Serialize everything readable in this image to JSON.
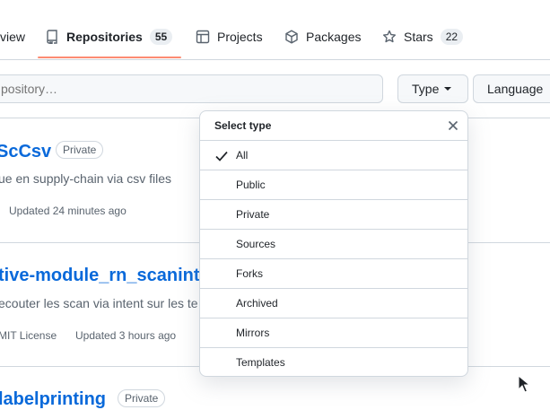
{
  "nav": {
    "overview_label": "view",
    "repositories_label": "Repositories",
    "repositories_count": "55",
    "projects_label": "Projects",
    "packages_label": "Packages",
    "stars_label": "Stars",
    "stars_count": "22"
  },
  "filters": {
    "search_placeholder": "pository…",
    "type_button": "Type",
    "language_button": "Language"
  },
  "repos": [
    {
      "name": "ScCsv",
      "visibility": "Private",
      "description": "ue en supply-chain via csv files",
      "meta": [
        "Updated 24 minutes ago"
      ]
    },
    {
      "name": "tive-module_rn_scanint",
      "description": "ecouter les scan via intent sur les te",
      "meta": [
        "MIT License",
        "Updated 3 hours ago"
      ]
    },
    {
      "name": "labelprinting",
      "visibility": "Private"
    }
  ],
  "dropdown": {
    "title": "Select type",
    "selected": "All",
    "items": [
      "All",
      "Public",
      "Private",
      "Sources",
      "Forks",
      "Archived",
      "Mirrors",
      "Templates"
    ]
  },
  "colors": {
    "accent_link": "#0969da",
    "underline": "#fd8c73",
    "border": "#d0d7de",
    "muted_text": "#59636e"
  },
  "icons": {
    "repositories": "repo-icon",
    "projects": "table-icon",
    "packages": "package-icon",
    "stars": "star-icon",
    "close": "close-icon",
    "check": "check-icon",
    "cursor": "mouse-pointer-icon"
  }
}
